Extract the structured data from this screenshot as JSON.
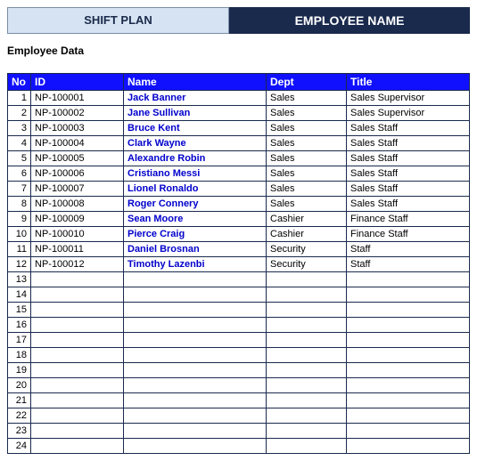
{
  "header": {
    "left": "SHIFT PLAN",
    "right": "EMPLOYEE NAME"
  },
  "section_title": "Employee Data",
  "columns": {
    "no": "No",
    "id": "ID",
    "name": "Name",
    "dept": "Dept",
    "title": "Title"
  },
  "total_rows": 24,
  "rows": [
    {
      "no": "1",
      "id": "NP-100001",
      "name": "Jack Banner",
      "dept": "Sales",
      "title": "Sales Supervisor"
    },
    {
      "no": "2",
      "id": "NP-100002",
      "name": "Jane Sullivan",
      "dept": "Sales",
      "title": "Sales Supervisor"
    },
    {
      "no": "3",
      "id": "NP-100003",
      "name": "Bruce Kent",
      "dept": "Sales",
      "title": "Sales Staff"
    },
    {
      "no": "4",
      "id": "NP-100004",
      "name": "Clark Wayne",
      "dept": "Sales",
      "title": "Sales Staff"
    },
    {
      "no": "5",
      "id": "NP-100005",
      "name": "Alexandre Robin",
      "dept": "Sales",
      "title": "Sales Staff"
    },
    {
      "no": "6",
      "id": "NP-100006",
      "name": "Cristiano Messi",
      "dept": "Sales",
      "title": "Sales Staff"
    },
    {
      "no": "7",
      "id": "NP-100007",
      "name": "Lionel Ronaldo",
      "dept": "Sales",
      "title": "Sales Staff"
    },
    {
      "no": "8",
      "id": "NP-100008",
      "name": "Roger Connery",
      "dept": "Sales",
      "title": "Sales Staff"
    },
    {
      "no": "9",
      "id": "NP-100009",
      "name": "Sean Moore",
      "dept": "Cashier",
      "title": "Finance Staff"
    },
    {
      "no": "10",
      "id": "NP-100010",
      "name": "Pierce Craig",
      "dept": "Cashier",
      "title": "Finance Staff"
    },
    {
      "no": "11",
      "id": "NP-100011",
      "name": "Daniel Brosnan",
      "dept": "Security",
      "title": "Staff"
    },
    {
      "no": "12",
      "id": "NP-100012",
      "name": "Timothy Lazenbi",
      "dept": "Security",
      "title": "Staff"
    }
  ]
}
